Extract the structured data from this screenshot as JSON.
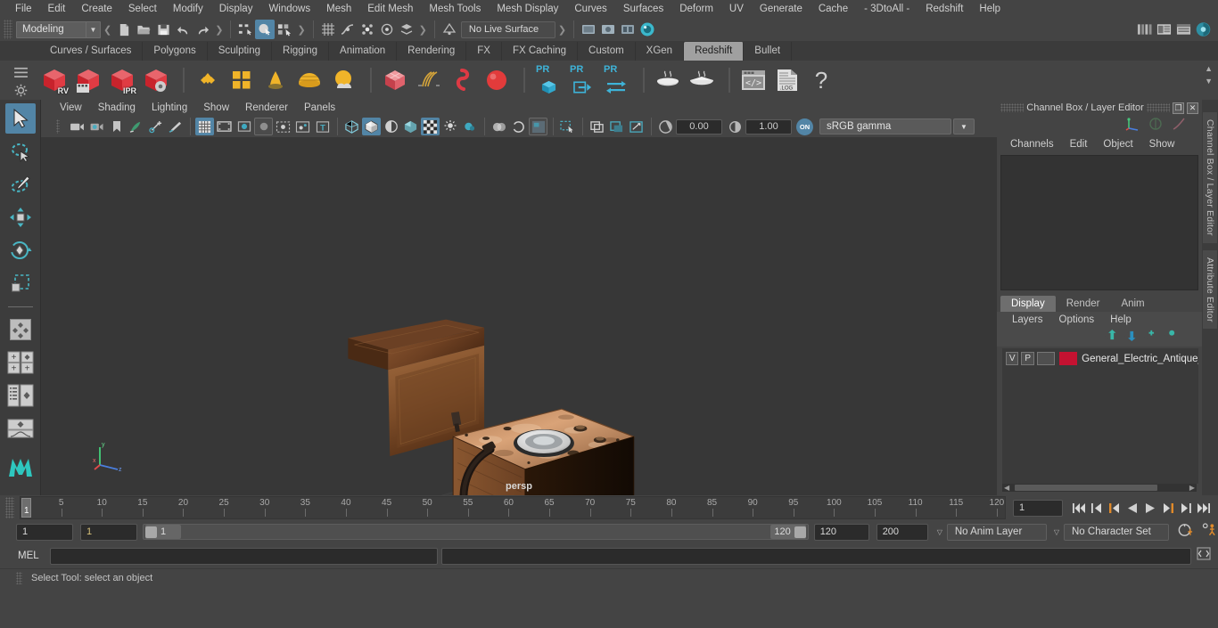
{
  "app": {
    "title": "Autodesk Maya"
  },
  "menubar": {
    "items": [
      "File",
      "Edit",
      "Create",
      "Select",
      "Modify",
      "Display",
      "Windows",
      "Mesh",
      "Edit Mesh",
      "Mesh Tools",
      "Mesh Display",
      "Curves",
      "Surfaces",
      "Deform",
      "UV",
      "Generate",
      "Cache",
      "- 3DtoAll -",
      "Redshift",
      "Help"
    ]
  },
  "statusline": {
    "mode": "Modeling",
    "no_live_surface": "No Live Surface",
    "icons": [
      "new-scene-icon",
      "open-scene-icon",
      "save-scene-icon",
      "undo-icon",
      "redo-icon",
      "select-by-hierarchy-icon",
      "select-by-object-icon",
      "select-by-component-icon",
      "snap-grid-icon",
      "snap-curve-icon",
      "snap-point-icon",
      "snap-projected-center-icon",
      "snap-view-plane-icon",
      "make-live-icon",
      "render-view-icon",
      "render-icon",
      "ipr-render-icon",
      "render-settings-icon"
    ],
    "right_icons": [
      "toggle-modeling-toolkit-icon",
      "toggle-attribute-editor-icon",
      "toggle-tool-settings-icon",
      "toggle-channel-box-icon"
    ]
  },
  "shelf": {
    "tabs": [
      "Curves / Surfaces",
      "Polygons",
      "Sculpting",
      "Rigging",
      "Animation",
      "Rendering",
      "FX",
      "FX Caching",
      "Custom",
      "XGen",
      "Redshift",
      "Bullet"
    ],
    "active_tab": "Redshift",
    "buttons": [
      {
        "name": "redshift-render-view",
        "label": "RV"
      },
      {
        "name": "redshift-render-sequence",
        "label": ""
      },
      {
        "name": "redshift-ipr",
        "label": "IPR"
      },
      {
        "name": "redshift-render-settings",
        "label": ""
      },
      {
        "name": "redshift-material",
        "label": ""
      },
      {
        "name": "redshift-material-blender",
        "label": ""
      },
      {
        "name": "redshift-light-ies",
        "label": ""
      },
      {
        "name": "redshift-dome-light",
        "label": ""
      },
      {
        "name": "redshift-physical-sun",
        "label": ""
      },
      {
        "name": "redshift-proxy",
        "label": ""
      },
      {
        "name": "redshift-hair",
        "label": ""
      },
      {
        "name": "redshift-curve",
        "label": ""
      },
      {
        "name": "redshift-sphere-primitive",
        "label": ""
      },
      {
        "name": "redshift-pr-object",
        "label": "PR"
      },
      {
        "name": "redshift-pr-export",
        "label": "PR"
      },
      {
        "name": "redshift-pr-transfer",
        "label": "PR"
      },
      {
        "name": "redshift-bake-set",
        "label": ""
      },
      {
        "name": "redshift-bake-render",
        "label": ""
      },
      {
        "name": "redshift-script-editor",
        "label": ""
      },
      {
        "name": "redshift-log",
        "label": ".LOG"
      },
      {
        "name": "redshift-help",
        "label": "?"
      }
    ]
  },
  "toolbox": {
    "items": [
      "select-tool",
      "lasso-select-tool",
      "paint-select-tool",
      "move-tool",
      "rotate-tool",
      "scale-tool",
      "last-tool-used",
      "four-view-layout",
      "two-pane-layout",
      "outliner-persp-layout",
      "persp-graph-layout",
      "maya-logo"
    ]
  },
  "viewport": {
    "menus": [
      "View",
      "Shading",
      "Lighting",
      "Show",
      "Renderer",
      "Panels"
    ],
    "camera_label": "persp",
    "exposure": "0.00",
    "gamma": "1.00",
    "color_management": "sRGB gamma",
    "color_mgmt_toggle": "ON",
    "axis": {
      "x": "x",
      "y": "y",
      "z": "z"
    }
  },
  "channelbox": {
    "title": "Channel Box / Layer Editor",
    "menus": [
      "Channels",
      "Edit",
      "Object",
      "Show"
    ],
    "side_tabs": [
      "Channel Box / Layer Editor",
      "Attribute Editor"
    ]
  },
  "layereditor": {
    "tabs": [
      "Display",
      "Render",
      "Anim"
    ],
    "active_tab": "Display",
    "menus": [
      "Layers",
      "Options",
      "Help"
    ],
    "layers": [
      {
        "visible": "V",
        "playback": "P",
        "color": "#c41231",
        "name": "General_Electric_Antique_"
      }
    ]
  },
  "timeslider": {
    "current_frame": "1",
    "current_frame_field": "1",
    "ticks": [
      5,
      10,
      15,
      20,
      25,
      30,
      35,
      40,
      45,
      50,
      55,
      60,
      65,
      70,
      75,
      80,
      85,
      90,
      95,
      100,
      105,
      110,
      115,
      120
    ],
    "playback_buttons": [
      "go-to-start",
      "step-back-keyframe",
      "step-back-frame",
      "play-backwards",
      "play-forwards",
      "step-forward-frame",
      "step-forward-keyframe",
      "go-to-end"
    ]
  },
  "rangeslider": {
    "start_field": "1",
    "playback_start_field": "1",
    "range_start_label": "1",
    "range_end_label": "120",
    "playback_end_field": "120",
    "end_field": "200",
    "anim_layer": "No Anim Layer",
    "character_set": "No Character Set",
    "icons": [
      "auto-keyframe-icon",
      "animation-preferences-icon"
    ]
  },
  "commandline": {
    "language_label": "MEL",
    "input_value": "",
    "script_editor_icon": "script-editor-icon"
  },
  "statusbar": {
    "message": "Select Tool: select an object"
  }
}
